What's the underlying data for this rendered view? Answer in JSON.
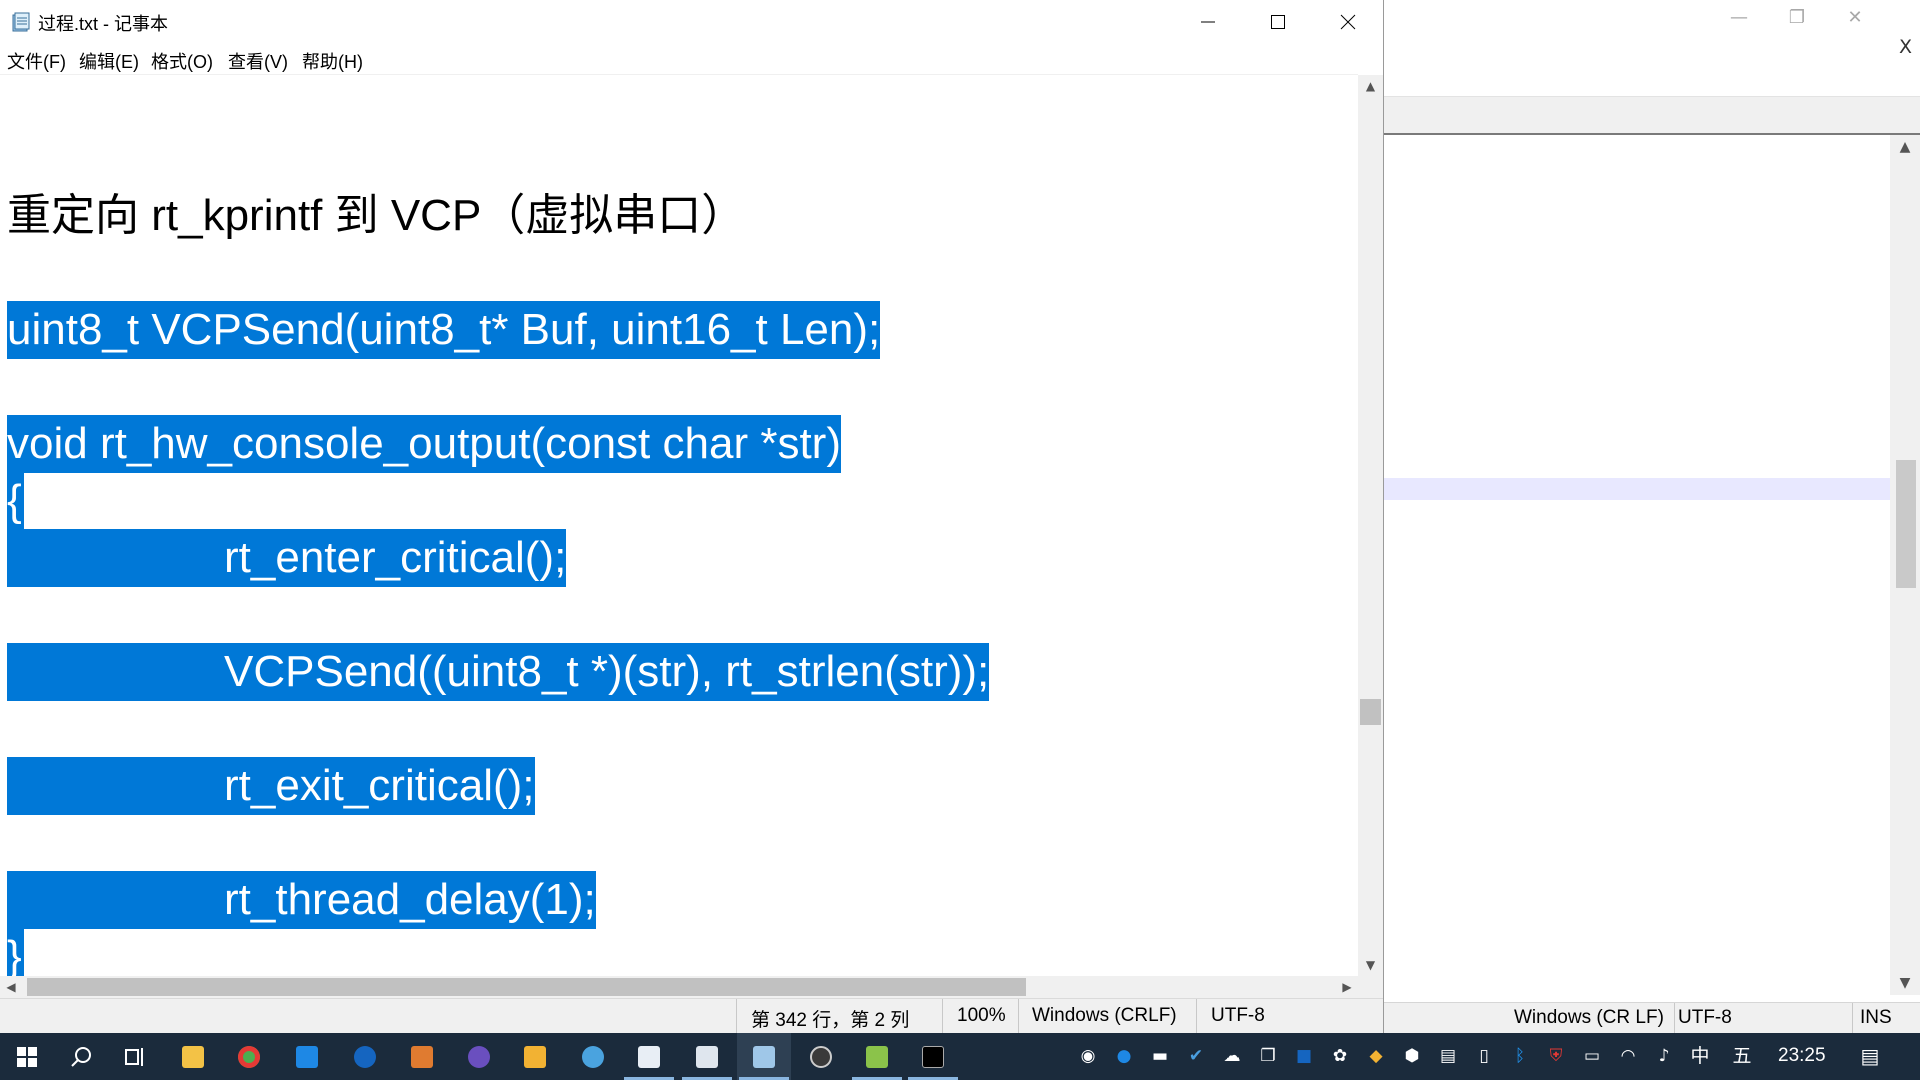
{
  "notepad": {
    "title": "过程.txt - 记事本",
    "menu": [
      "文件(F)",
      "编辑(E)",
      "格式(O)",
      "查看(V)",
      "帮助(H)"
    ],
    "heading_line": "重定向 rt_kprintf 到 VCP（虚拟串口）",
    "selected_lines": [
      "uint8_t VCPSend(uint8_t* Buf, uint16_t Len);",
      "void rt_hw_console_output(const char *str)",
      "{",
      "\t\trt_enter_critical();",
      "\t\tVCPSend((uint8_t *)(str), rt_strlen(str));",
      "\t\trt_exit_critical();",
      "\t\trt_thread_delay(1);",
      "}"
    ],
    "status": {
      "position": "第 342 行，第 2 列",
      "zoom": "100%",
      "line_ending": "Windows (CRLF)",
      "encoding": "UTF-8"
    },
    "vertical_scroll_position": 0.62,
    "selection_color": "#0078d7"
  },
  "background_window": {
    "close_label": "X",
    "status": {
      "line_ending": "Windows (CR LF)",
      "encoding": "UTF-8",
      "mode": "INS"
    }
  },
  "taskbar": {
    "clock": "23:25",
    "ime_lang": "中",
    "ime_mode": "五",
    "apps": [
      "start-icon",
      "search-icon",
      "task-view-icon",
      "file-explorer-icon",
      "chrome-icon",
      "app-blue-icon",
      "app-gear-icon",
      "app-orange-icon",
      "app-purple-icon",
      "app-yellow-icon",
      "app-globe-icon",
      "vscode-icon",
      "photos-icon",
      "notepad-icon",
      "obs-icon",
      "notepad-plus-icon",
      "terminal-icon"
    ],
    "background_color": "#1b2b3c"
  }
}
